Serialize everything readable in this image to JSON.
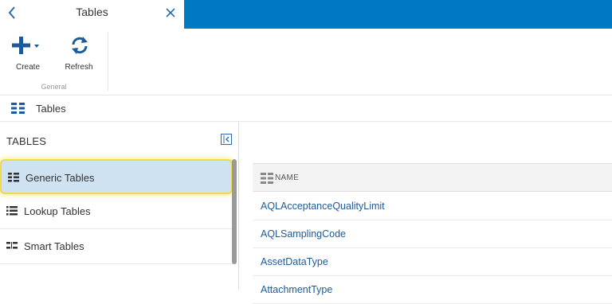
{
  "panel": {
    "title": "Tables"
  },
  "ribbon": {
    "buttons": [
      {
        "label": "Create",
        "icon": "plus-icon"
      },
      {
        "label": "Refresh",
        "icon": "refresh-icon"
      }
    ],
    "group_label": "General"
  },
  "breadcrumb": {
    "label": "Tables",
    "icon": "table-icon"
  },
  "left_pane": {
    "title": "TABLES",
    "items": [
      {
        "label": "Generic Tables",
        "icon": "generic-table-icon",
        "selected": true
      },
      {
        "label": "Lookup Tables",
        "icon": "list-icon",
        "selected": false
      },
      {
        "label": "Smart Tables",
        "icon": "smart-table-icon",
        "selected": false
      }
    ]
  },
  "grid": {
    "column_header": "NAME",
    "rows": [
      "AQLAcceptanceQualityLimit",
      "AQLSamplingCode",
      "AssetDataType",
      "AttachmentType"
    ]
  },
  "colors": {
    "accent": "#0079c2",
    "selection": "#cfe2f1",
    "highlight": "#f0d94a",
    "link": "#1d5a9a"
  }
}
